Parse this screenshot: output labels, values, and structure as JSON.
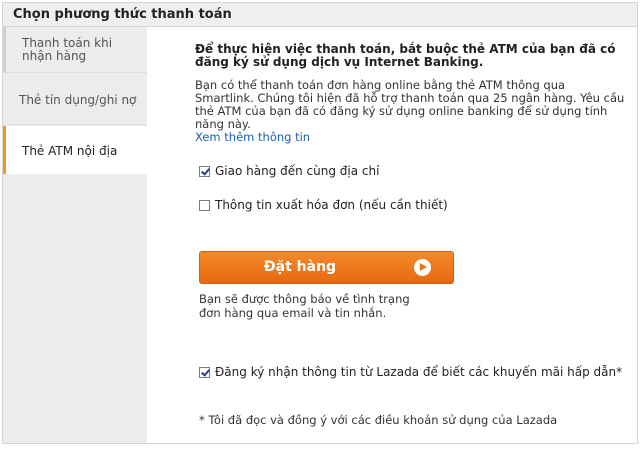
{
  "header": {
    "title": "Chọn phương thức thanh toán"
  },
  "sidebar": {
    "tabs": [
      {
        "label": "Thanh toán khi nhận hàng"
      },
      {
        "label": "Thẻ tín dụng/ghi nợ"
      },
      {
        "label": "Thẻ ATM nội địa"
      }
    ]
  },
  "main": {
    "intro_bold": "Để thực hiện việc thanh toán, bắt buộc thẻ ATM của bạn đã có đăng ký sử dụng dịch vụ Internet Banking.",
    "intro_text": "Bạn có thể thanh toán đơn hàng online bằng thẻ ATM thông qua Smartlink. Chúng tôi hiện đã hỗ trợ thanh toán qua 25 ngân hàng. Yêu cầu thẻ ATM của bạn đã có đăng ký sử dụng online banking để sử dụng tính năng này.",
    "more_link": "Xem thêm thông tin",
    "checkbox_delivery": {
      "label": "Giao hàng đến cùng địa chỉ",
      "checked": true
    },
    "checkbox_invoice": {
      "label": "Thông tin xuất hóa đơn (nếu cần thiết)",
      "checked": false
    },
    "order_button": "Đặt hàng",
    "notice": "Bạn sẽ được thông báo về tình trạng đơn hàng qua email và tin nhắn.",
    "checkbox_subscribe": {
      "label": "Đăng ký nhận thông tin từ Lazada để biết các khuyến mãi hấp dẫn*",
      "checked": true
    },
    "terms": "* Tôi đã đọc và đồng ý với các điều khoản sử dụng của Lazada"
  },
  "colors": {
    "accent": "#f7941d",
    "button": "#ee7518",
    "link": "#1a5fb4"
  }
}
